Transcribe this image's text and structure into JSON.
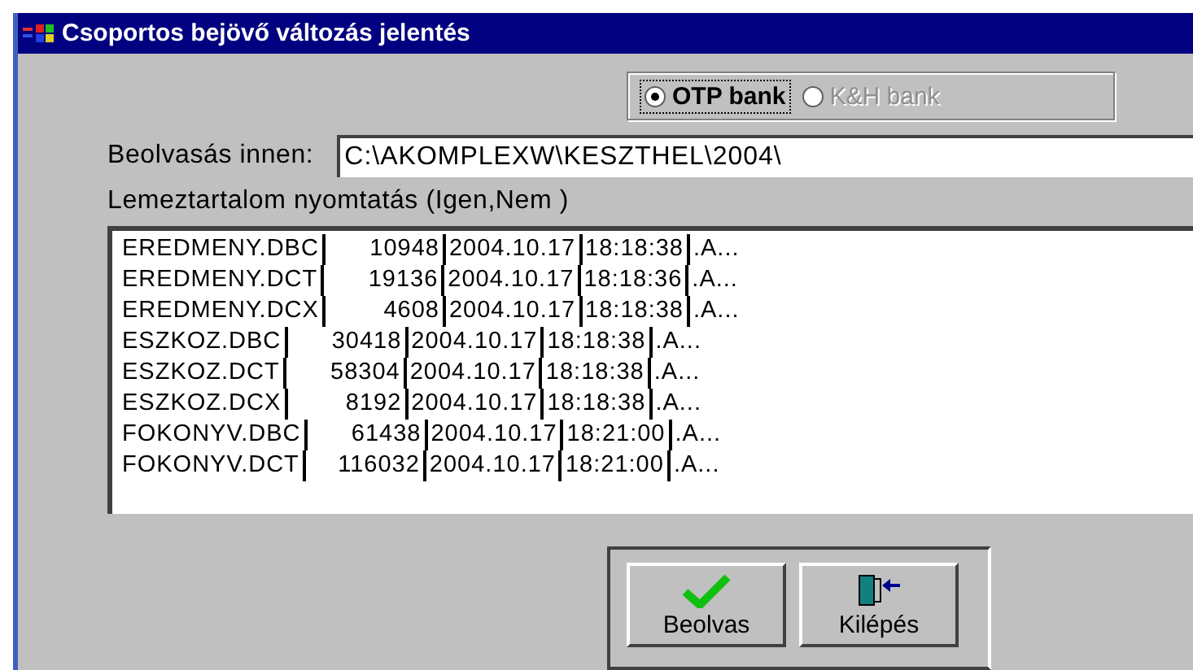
{
  "window": {
    "title": "Csoportos bejövő változás jelentés"
  },
  "bank_options": [
    {
      "label": "OTP bank",
      "selected": true,
      "disabled": false
    },
    {
      "label": "K&H bank",
      "selected": false,
      "disabled": true
    }
  ],
  "source": {
    "label": "Beolvasás innen:",
    "value": "C:\\AKOMPLEXW\\KESZTHEL\\2004\\"
  },
  "print_label": "Lemeztartalom nyomtatás (Igen,Nem )",
  "files": [
    {
      "name": "EREDMENY.DBC",
      "size": "10948",
      "date": "2004.10.17",
      "time": "18:18:38",
      "attr": ".A..."
    },
    {
      "name": "EREDMENY.DCT",
      "size": "19136",
      "date": "2004.10.17",
      "time": "18:18:36",
      "attr": ".A..."
    },
    {
      "name": "EREDMENY.DCX",
      "size": "4608",
      "date": "2004.10.17",
      "time": "18:18:38",
      "attr": ".A..."
    },
    {
      "name": "ESZKOZ.DBC",
      "size": "30418",
      "date": "2004.10.17",
      "time": "18:18:38",
      "attr": ".A..."
    },
    {
      "name": "ESZKOZ.DCT",
      "size": "58304",
      "date": "2004.10.17",
      "time": "18:18:38",
      "attr": ".A..."
    },
    {
      "name": "ESZKOZ.DCX",
      "size": "8192",
      "date": "2004.10.17",
      "time": "18:18:38",
      "attr": ".A..."
    },
    {
      "name": "FOKONYV.DBC",
      "size": "61438",
      "date": "2004.10.17",
      "time": "18:21:00",
      "attr": ".A..."
    },
    {
      "name": "FOKONYV.DCT",
      "size": "116032",
      "date": "2004.10.17",
      "time": "18:21:00",
      "attr": ".A..."
    }
  ],
  "buttons": [
    {
      "label": "Beolvas",
      "kind": "read"
    },
    {
      "label": "Kilépés",
      "kind": "exit"
    }
  ]
}
